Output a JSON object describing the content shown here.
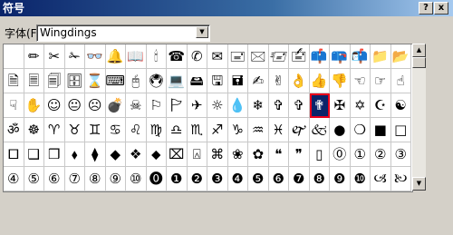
{
  "window": {
    "title": "符号",
    "help_label": "?",
    "close_label": "x"
  },
  "font_selector": {
    "label": "字体(F):",
    "value": "Wingdings",
    "dropdown_icon": "▼"
  },
  "scrollbar": {
    "up_icon": "▲",
    "down_icon": "▼"
  },
  "symbols": {
    "selected_index": 55,
    "rows": [
      [
        "",
        "✏",
        "✂",
        "✁",
        "👓",
        "🔔",
        "📖",
        "🕯",
        "☎",
        "✆",
        "✉",
        "🖃",
        "🖂",
        "🖅",
        "🖆",
        "📫",
        "📪",
        "📬",
        "📁",
        "📂"
      ],
      [
        "🗎",
        "🗏",
        "🗐",
        "🗄",
        "⌛",
        "⌨",
        "🖰",
        "🖲",
        "💻",
        "🖴",
        "🖫",
        "🖬",
        "✍",
        "✌",
        "👌",
        "👍",
        "👎",
        "☜",
        "☞",
        "☝"
      ],
      [
        "☟",
        "✋",
        "☺",
        "😐",
        "☹",
        "💣",
        "☠",
        "⚐",
        "🏱",
        "✈",
        "☼",
        "💧",
        "❄",
        "✞",
        "✞",
        "✟",
        "✠",
        "✡",
        "☪",
        "☯"
      ],
      [
        "ॐ",
        "☸",
        "♈",
        "♉",
        "♊",
        "♋",
        "♌",
        "♍",
        "♎",
        "♏",
        "♐",
        "♑",
        "♒",
        "♓",
        "🙰",
        "🙵",
        "●",
        "❍",
        "■",
        "□"
      ],
      [
        "🞐",
        "❑",
        "❒",
        "⬧",
        "⧫",
        "◆",
        "❖",
        "⬥",
        "⌧",
        "⍓",
        "⌘",
        "❀",
        "✿",
        "❝",
        "❞",
        "▯",
        "⓪",
        "①",
        "②",
        "③"
      ],
      [
        "④",
        "⑤",
        "⑥",
        "⑦",
        "⑧",
        "⑨",
        "⑩",
        "⓿",
        "❶",
        "❷",
        "❸",
        "❹",
        "❺",
        "❻",
        "❼",
        "❽",
        "❾",
        "❿",
        "🙢",
        "🙠"
      ]
    ]
  }
}
